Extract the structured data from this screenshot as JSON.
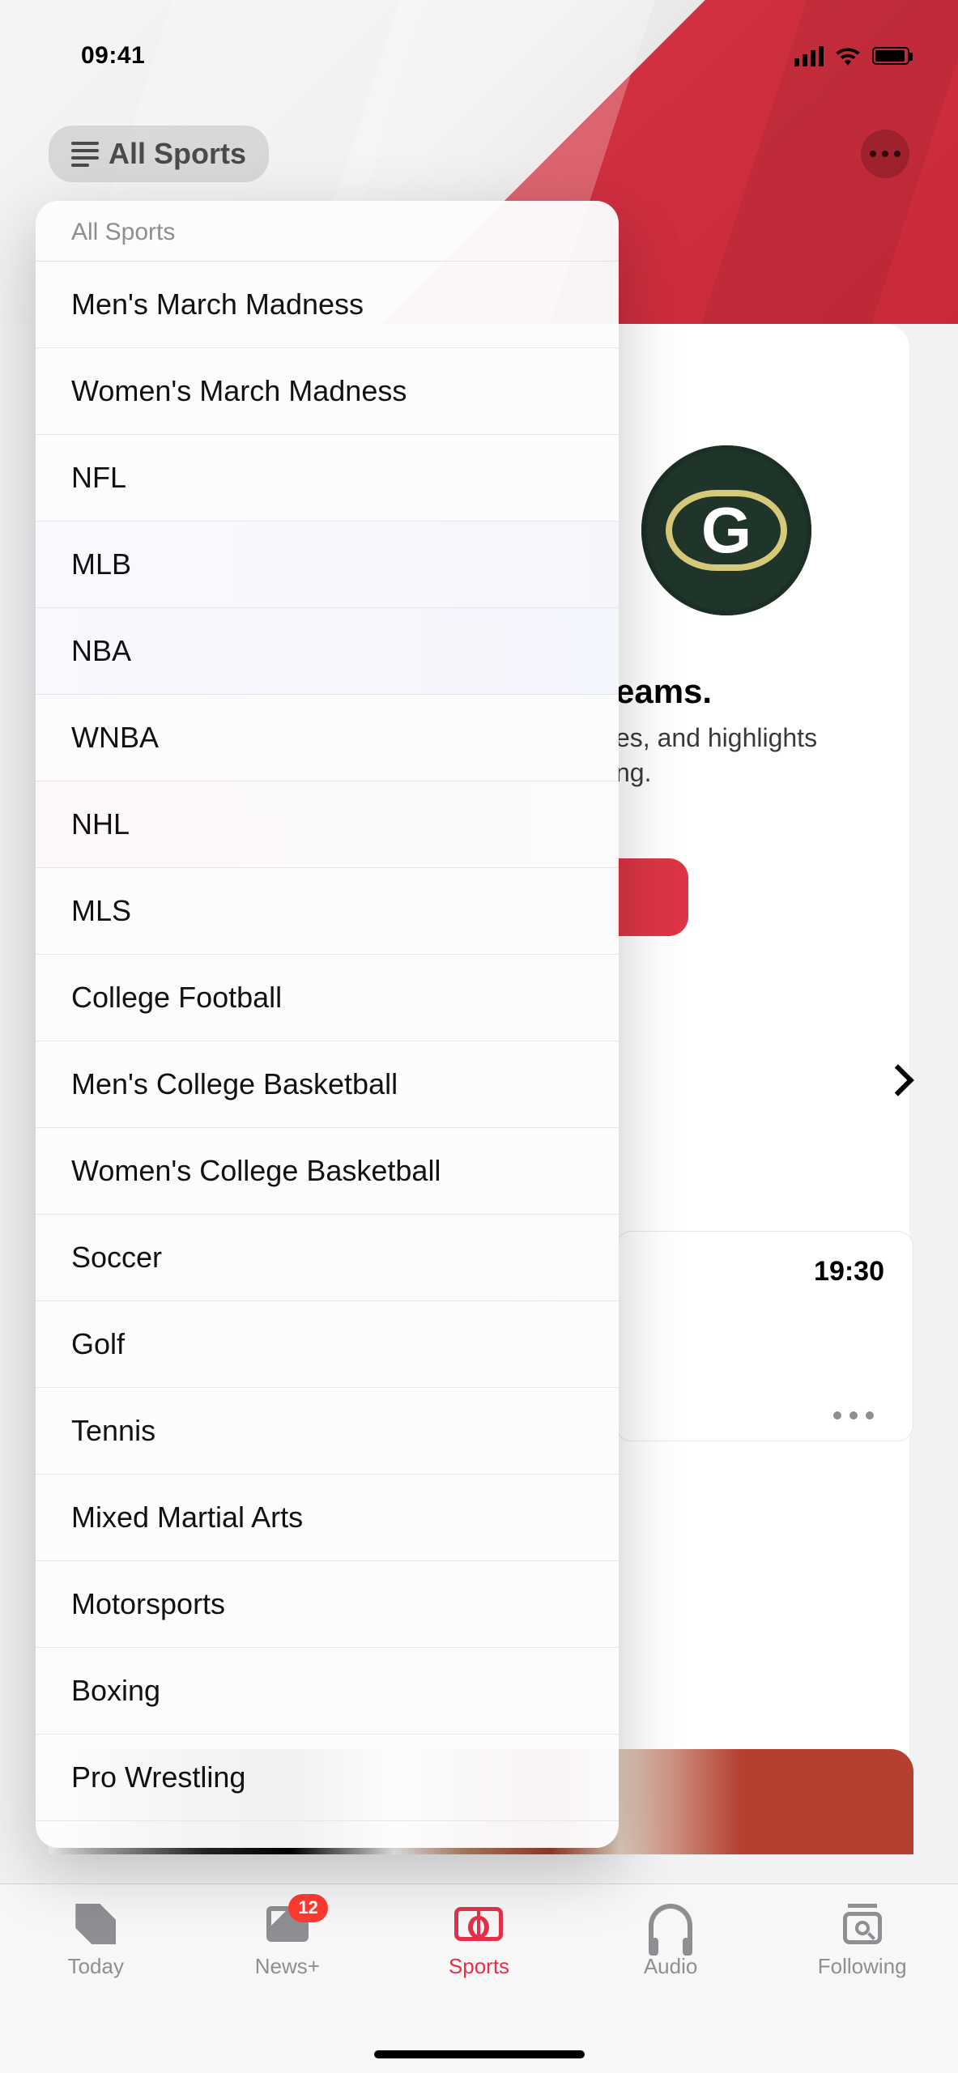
{
  "status": {
    "time": "09:41"
  },
  "nav": {
    "chip_label": "All Sports"
  },
  "dropdown": {
    "header": "All Sports",
    "items": [
      "Men's March Madness",
      "Women's March Madness",
      "NFL",
      "MLB",
      "NBA",
      "WNBA",
      "NHL",
      "MLS",
      "College Football",
      "Men's College Basketball",
      "Women's College Basketball",
      "Soccer",
      "Golf",
      "Tennis",
      "Mixed Martial Arts",
      "Motorsports",
      "Boxing",
      "Pro Wrestling"
    ]
  },
  "background": {
    "team_logo_letter": "G",
    "headline_fragment": "eams.",
    "sub_fragment_line1": "es, and highlights",
    "sub_fragment_line2": "ng.",
    "score_time": "19:30"
  },
  "tabs": {
    "today": "Today",
    "newsplus": "News+",
    "newsplus_badge": "12",
    "sports": "Sports",
    "audio": "Audio",
    "following": "Following"
  }
}
